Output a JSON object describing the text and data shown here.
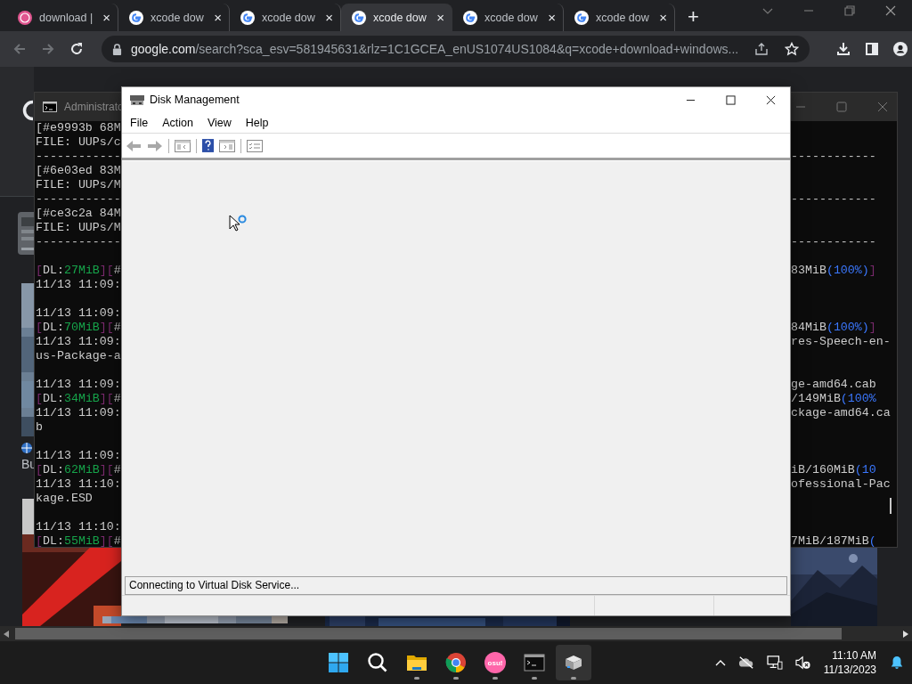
{
  "browser": {
    "tabs": [
      {
        "title": "download |",
        "kind": "osu",
        "selected": false,
        "close": "×"
      },
      {
        "title": "xcode dow",
        "kind": "google",
        "selected": false,
        "close": "×"
      },
      {
        "title": "xcode dow",
        "kind": "google",
        "selected": false,
        "close": "×"
      },
      {
        "title": "xcode dow",
        "kind": "google",
        "selected": true,
        "close": "×"
      },
      {
        "title": "xcode dow",
        "kind": "google",
        "selected": false,
        "close": "×"
      },
      {
        "title": "xcode dow",
        "kind": "google",
        "selected": false,
        "close": "×"
      }
    ],
    "new_tab": "+",
    "address": {
      "host": "google.com",
      "path": "/search?sca_esv=581945631&rlz=1C1GCEA_enUS1074US1084&q=xcode+download+windows..."
    }
  },
  "page": {
    "text_fragment": "Bu"
  },
  "console": {
    "title": "Administrato",
    "lines": [
      {
        "kind": "text",
        "left": [
          {
            "kind": "plain",
            "text": "[#e9993b 68M"
          }
        ]
      },
      {
        "kind": "text",
        "left": [
          {
            "kind": "plain",
            "text": "FILE: UUPs/c"
          }
        ]
      },
      {
        "kind": "text",
        "left": [
          {
            "kind": "plain",
            "text": "------------"
          }
        ],
        "right": [
          {
            "kind": "plain",
            "text": "------------"
          }
        ]
      },
      {
        "kind": "text",
        "left": [
          {
            "kind": "plain",
            "text": "[#6e03ed 83M"
          }
        ]
      },
      {
        "kind": "text",
        "left": [
          {
            "kind": "plain",
            "text": "FILE: UUPs/M"
          }
        ]
      },
      {
        "kind": "text",
        "left": [
          {
            "kind": "plain",
            "text": "------------"
          }
        ],
        "right": [
          {
            "kind": "plain",
            "text": "------------"
          }
        ]
      },
      {
        "kind": "text",
        "left": [
          {
            "kind": "plain",
            "text": "[#ce3c2a 84M"
          }
        ]
      },
      {
        "kind": "text",
        "left": [
          {
            "kind": "plain",
            "text": "FILE: UUPs/M"
          }
        ]
      },
      {
        "kind": "text",
        "left": [
          {
            "kind": "plain",
            "text": "------------"
          }
        ],
        "right": [
          {
            "kind": "plain",
            "text": "------------"
          }
        ]
      },
      {
        "kind": "blank"
      },
      {
        "kind": "text",
        "left": [
          {
            "kind": "bracket",
            "text": "["
          },
          {
            "kind": "plain",
            "text": "DL:"
          },
          {
            "kind": "size",
            "text": "27MiB"
          },
          {
            "kind": "bracket",
            "text": "]["
          },
          {
            "kind": "plain",
            "text": "#"
          }
        ],
        "right": [
          {
            "kind": "plain",
            "text": "83MiB"
          },
          {
            "kind": "percent",
            "text": "(100%)"
          },
          {
            "kind": "bracket",
            "text": "]"
          }
        ]
      },
      {
        "kind": "text",
        "left": [
          {
            "kind": "plain",
            "text": "11/13 11:09:"
          }
        ]
      },
      {
        "kind": "blank"
      },
      {
        "kind": "text",
        "left": [
          {
            "kind": "plain",
            "text": "11/13 11:09:"
          }
        ]
      },
      {
        "kind": "text",
        "left": [
          {
            "kind": "bracket",
            "text": "["
          },
          {
            "kind": "plain",
            "text": "DL:"
          },
          {
            "kind": "size",
            "text": "70MiB"
          },
          {
            "kind": "bracket",
            "text": "]["
          },
          {
            "kind": "plain",
            "text": "#"
          }
        ],
        "right": [
          {
            "kind": "plain",
            "text": "84MiB"
          },
          {
            "kind": "percent",
            "text": "(100%)"
          },
          {
            "kind": "bracket",
            "text": "]"
          }
        ]
      },
      {
        "kind": "text",
        "left": [
          {
            "kind": "plain",
            "text": "11/13 11:09:"
          }
        ],
        "right": [
          {
            "kind": "plain",
            "text": "res-Speech-en-"
          }
        ]
      },
      {
        "kind": "text",
        "left": [
          {
            "kind": "plain",
            "text": "us-Package-a"
          }
        ]
      },
      {
        "kind": "blank"
      },
      {
        "kind": "text",
        "left": [
          {
            "kind": "plain",
            "text": "11/13 11:09:"
          }
        ],
        "right": [
          {
            "kind": "plain",
            "text": "ge-amd64.cab"
          }
        ]
      },
      {
        "kind": "text",
        "left": [
          {
            "kind": "bracket",
            "text": "["
          },
          {
            "kind": "plain",
            "text": "DL:"
          },
          {
            "kind": "size",
            "text": "34MiB"
          },
          {
            "kind": "bracket",
            "text": "]["
          },
          {
            "kind": "plain",
            "text": "#"
          }
        ],
        "right": [
          {
            "kind": "plain",
            "text": "/149MiB"
          },
          {
            "kind": "percent",
            "text": "(100%"
          }
        ]
      },
      {
        "kind": "text",
        "left": [
          {
            "kind": "plain",
            "text": "11/13 11:09:"
          }
        ],
        "right": [
          {
            "kind": "plain",
            "text": "ckage-amd64.ca"
          }
        ]
      },
      {
        "kind": "text",
        "left": [
          {
            "kind": "plain",
            "text": "b"
          }
        ]
      },
      {
        "kind": "blank"
      },
      {
        "kind": "text",
        "left": [
          {
            "kind": "plain",
            "text": "11/13 11:09:"
          }
        ]
      },
      {
        "kind": "text",
        "left": [
          {
            "kind": "bracket",
            "text": "["
          },
          {
            "kind": "plain",
            "text": "DL:"
          },
          {
            "kind": "size",
            "text": "62MiB"
          },
          {
            "kind": "bracket",
            "text": "]["
          },
          {
            "kind": "plain",
            "text": "#"
          }
        ],
        "right": [
          {
            "kind": "plain",
            "text": "iB/160MiB"
          },
          {
            "kind": "percent",
            "text": "(10"
          }
        ]
      },
      {
        "kind": "text",
        "left": [
          {
            "kind": "plain",
            "text": "11/13 11:10:"
          }
        ],
        "right": [
          {
            "kind": "plain",
            "text": "ofessional-Pac"
          }
        ]
      },
      {
        "kind": "text",
        "left": [
          {
            "kind": "plain",
            "text": "kage.ESD"
          }
        ]
      },
      {
        "kind": "blank"
      },
      {
        "kind": "text",
        "left": [
          {
            "kind": "plain",
            "text": "11/13 11:10:"
          }
        ]
      },
      {
        "kind": "text",
        "left": [
          {
            "kind": "bracket",
            "text": "["
          },
          {
            "kind": "plain",
            "text": "DL:"
          },
          {
            "kind": "size",
            "text": "55MiB"
          },
          {
            "kind": "bracket",
            "text": "]["
          },
          {
            "kind": "plain",
            "text": "#"
          }
        ],
        "right": [
          {
            "kind": "plain",
            "text": "7MiB/187MiB"
          },
          {
            "kind": "percent",
            "text": "("
          }
        ]
      }
    ]
  },
  "disk_management": {
    "title": "Disk Management",
    "menu": [
      "File",
      "Action",
      "View",
      "Help"
    ],
    "status": "Connecting to Virtual Disk Service..."
  },
  "taskbar": {
    "apps": [
      {
        "kind": "start",
        "running": false,
        "selected": false
      },
      {
        "kind": "search",
        "running": false,
        "selected": false
      },
      {
        "kind": "explorer",
        "running": true,
        "selected": false
      },
      {
        "kind": "browser",
        "running": true,
        "selected": false
      },
      {
        "kind": "osu",
        "label": "osu!",
        "running": true,
        "selected": false
      },
      {
        "kind": "terminal",
        "running": true,
        "selected": false
      },
      {
        "kind": "disk",
        "running": true,
        "selected": true
      }
    ],
    "time": "11:10 AM",
    "date": "11/13/2023"
  }
}
